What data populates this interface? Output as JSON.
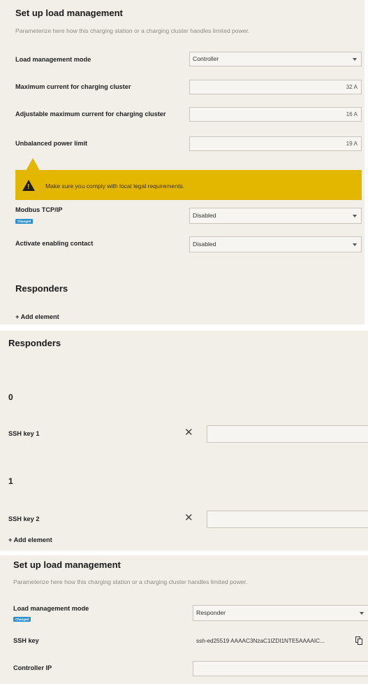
{
  "section1": {
    "title": "Set up load management",
    "subtitle": "Parameterize here how this charging station or a charging cluster handles limited power.",
    "load_mode": {
      "label": "Load management mode",
      "value": "Controller"
    },
    "max_current": {
      "label": "Maximum current for charging cluster",
      "value": "32 A"
    },
    "adj_max_current": {
      "label": "Adjustable maximum current for charging cluster",
      "value": "16 A"
    },
    "unbalanced": {
      "label": "Unbalanced power limit",
      "value": "19 A"
    },
    "warning": "Make sure you comply with local legal requirements.",
    "modbus": {
      "label": "Modbus TCP/IP",
      "badge": "Changed",
      "value": "Disabled"
    },
    "enabling": {
      "label": "Activate enabling contact",
      "value": "Disabled"
    },
    "responders_heading": "Responders",
    "add_element": "+ Add element"
  },
  "section2": {
    "heading": "Responders",
    "items": [
      {
        "index": "0",
        "label": "SSH key 1",
        "value": ""
      },
      {
        "index": "1",
        "label": "SSH key 2",
        "value": ""
      }
    ],
    "add_element": "+ Add element"
  },
  "section3": {
    "title": "Set up load management",
    "subtitle": "Parameterize here how this charging station or a charging cluster handles limited power.",
    "load_mode": {
      "label": "Load management mode",
      "badge": "Changed",
      "value": "Responder"
    },
    "ssh_key": {
      "label": "SSH key",
      "value": "ssh-ed25519 AAAAC3NzaC1lZDI1NTE5AAAAIC..."
    },
    "controller_ip": {
      "label": "Controller IP",
      "value": ""
    }
  },
  "colors": {
    "panel_bg": "#f2efe9",
    "warning": "#e3b600",
    "badge": "#2c8fd0"
  },
  "icons": [
    "warning-icon",
    "chevron-down-icon",
    "close-icon",
    "copy-icon"
  ]
}
